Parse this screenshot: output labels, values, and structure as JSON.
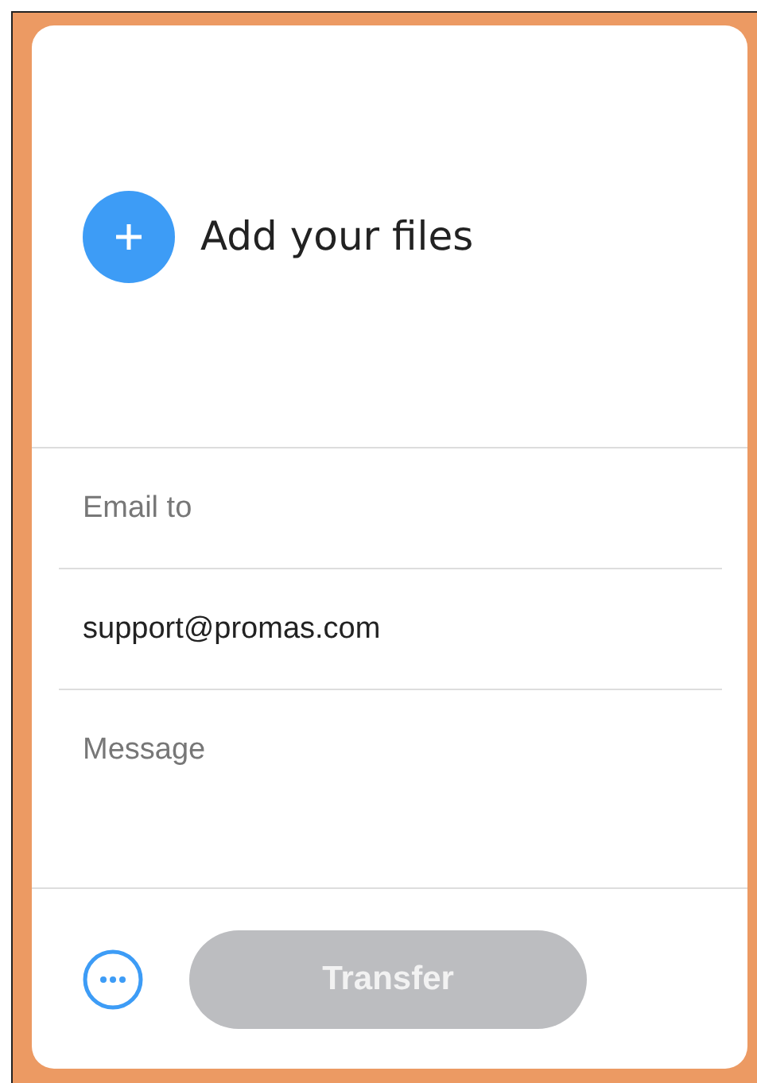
{
  "upload": {
    "label": "Add your files"
  },
  "fields": [
    {
      "kind": "input",
      "placeholder": "Email to"
    },
    {
      "kind": "input",
      "value": "support@promas.com"
    },
    {
      "kind": "textarea",
      "placeholder": "Message"
    }
  ],
  "transfer_button": {
    "label": "Transfer",
    "disabled": true
  }
}
